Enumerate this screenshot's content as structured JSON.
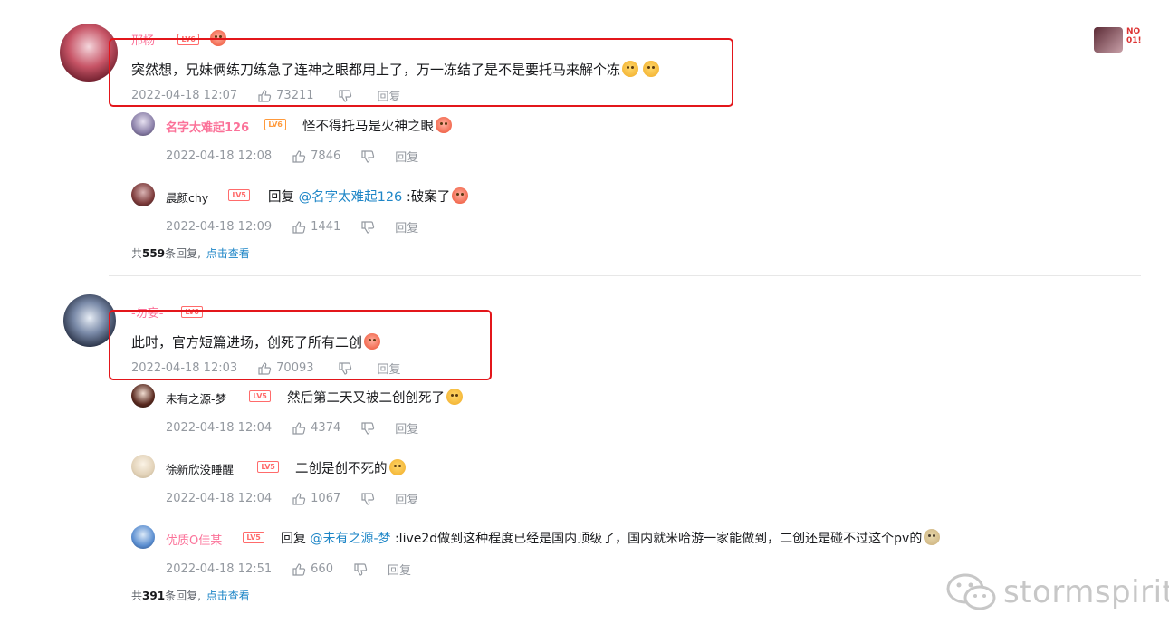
{
  "watermark": "stormspirit",
  "side_badge": "NO\n01!",
  "threads": [
    {
      "user": "邢杨",
      "level": "LV6",
      "content": "突然想，兄妹俩练刀练急了连神之眼都用上了，万一冻结了是不是要托马来解个冻",
      "time": "2022-04-18 12:07",
      "likes": "73211",
      "reply_label": "回复",
      "replies": [
        {
          "user": "名字太难起126",
          "level": "LV6",
          "prefix": "",
          "mention": "",
          "content": "怪不得托马是火神之眼",
          "time": "2022-04-18 12:08",
          "likes": "7846",
          "reply_label": "回复"
        },
        {
          "user": "晨颜chy",
          "level": "LV5",
          "prefix": "回复 ",
          "mention": "@名字太难起126",
          "content": " :破案了",
          "time": "2022-04-18 12:09",
          "likes": "1441",
          "reply_label": "回复"
        }
      ],
      "count_prefix": "共",
      "count": "559",
      "count_suffix": "条回复, ",
      "view_link": "点击查看"
    },
    {
      "user": "-勿妄-",
      "level": "LV6",
      "content": "此时，官方短篇进场，创死了所有二创",
      "time": "2022-04-18 12:03",
      "likes": "70093",
      "reply_label": "回复",
      "replies": [
        {
          "user": "未有之源-梦",
          "level": "LV5",
          "prefix": "",
          "mention": "",
          "content": "然后第二天又被二创创死了",
          "time": "2022-04-18 12:04",
          "likes": "4374",
          "reply_label": "回复"
        },
        {
          "user": "徐新欣没睡醒",
          "level": "LV5",
          "prefix": "",
          "mention": "",
          "content": "二创是创不死的",
          "time": "2022-04-18 12:04",
          "likes": "1067",
          "reply_label": "回复"
        },
        {
          "user": "优质O佳某",
          "level": "LV5",
          "prefix": "回复 ",
          "mention": "@未有之源-梦",
          "content": " :live2d做到这种程度已经是国内顶级了，国内就米哈游一家能做到，二创还是碰不过这个pv的",
          "time": "2022-04-18 12:51",
          "likes": "660",
          "reply_label": "回复"
        }
      ],
      "count_prefix": "共",
      "count": "391",
      "count_suffix": "条回复, ",
      "view_link": "点击查看"
    }
  ],
  "colors": {
    "accent_link": "#1e86c7",
    "vip_name": "#fb7299",
    "highlight_box": "#e3161b",
    "meta": "#9499a0"
  }
}
